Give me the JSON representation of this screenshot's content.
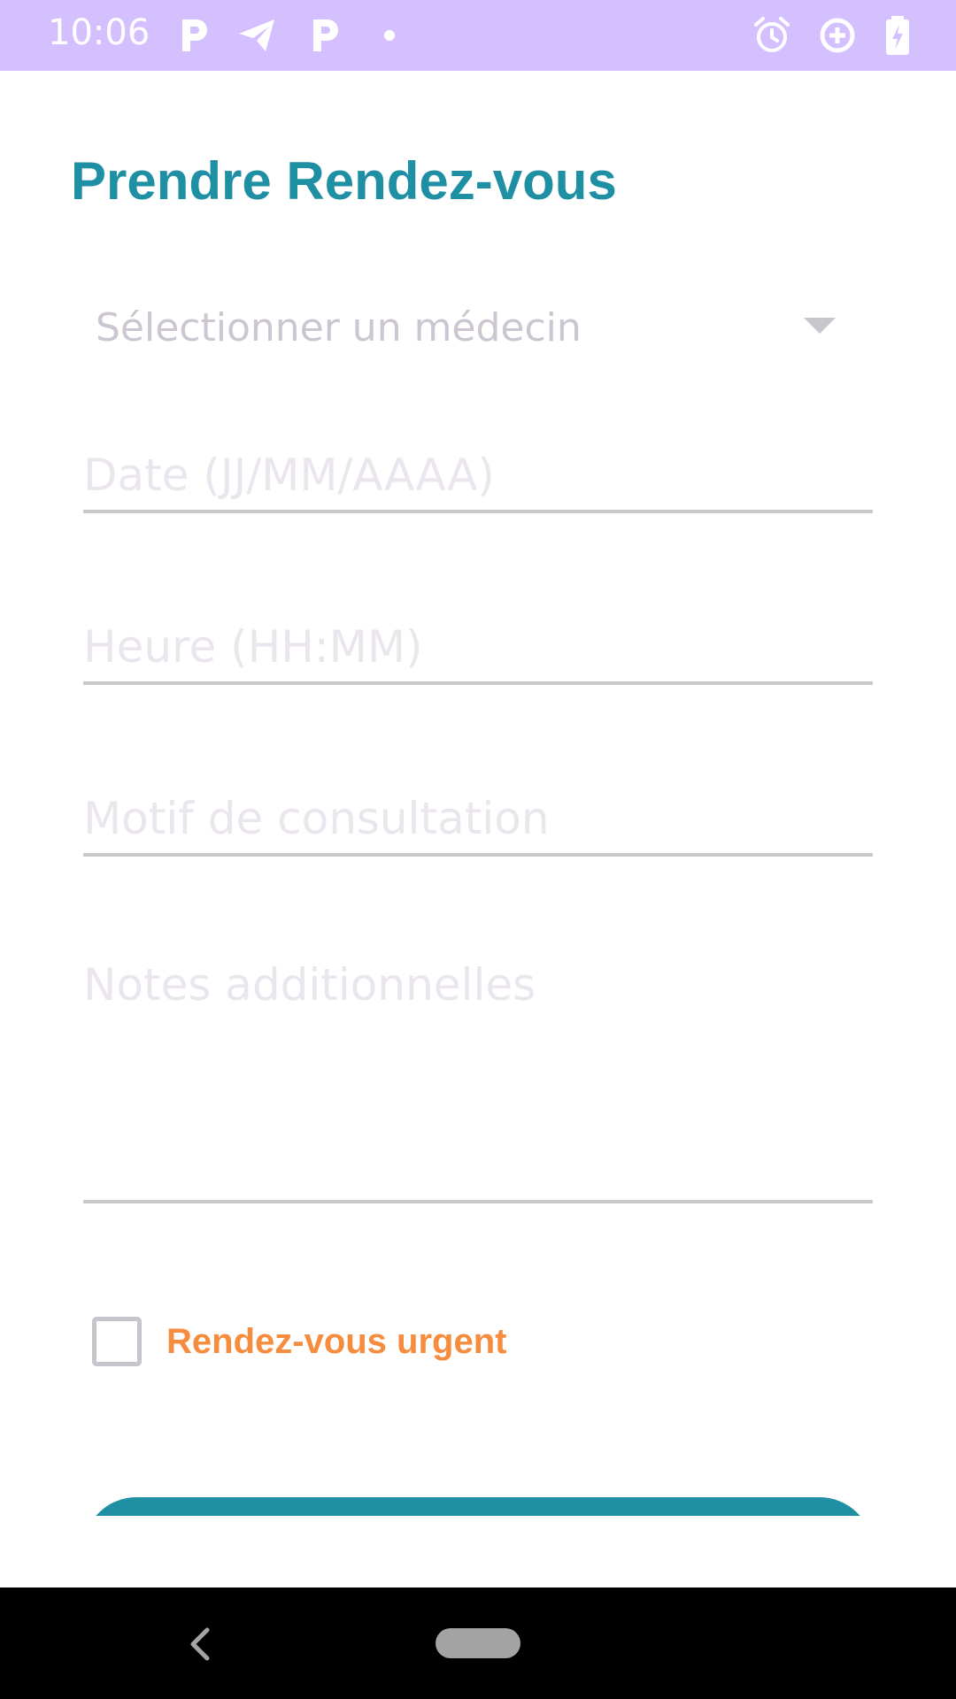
{
  "status_bar": {
    "time": "10:06",
    "left_icons": [
      "parking-p-icon",
      "telegram-icon",
      "parking-p-icon",
      "dot-icon"
    ],
    "right_icons": [
      "alarm-icon",
      "data-saver-icon",
      "battery-charging-icon"
    ]
  },
  "page": {
    "title": "Prendre Rendez-vous"
  },
  "form": {
    "doctor_spinner": {
      "placeholder": "Sélectionner un médecin"
    },
    "date": {
      "placeholder": "Date (JJ/MM/AAAA)",
      "value": ""
    },
    "time": {
      "placeholder": "Heure (HH:MM)",
      "value": ""
    },
    "reason": {
      "placeholder": "Motif de consultation",
      "value": ""
    },
    "notes": {
      "placeholder": "Notes additionnelles",
      "value": ""
    },
    "urgent": {
      "label": "Rendez-vous urgent",
      "checked": false
    }
  },
  "navigation": {
    "back_icon": "chevron-left-icon",
    "home_icon": "home-pill-icon"
  },
  "colors": {
    "status_bar": "#d4bfff",
    "title": "#1f8fa3",
    "urgent_label": "#f68c3e",
    "button": "#1f8fa3"
  }
}
